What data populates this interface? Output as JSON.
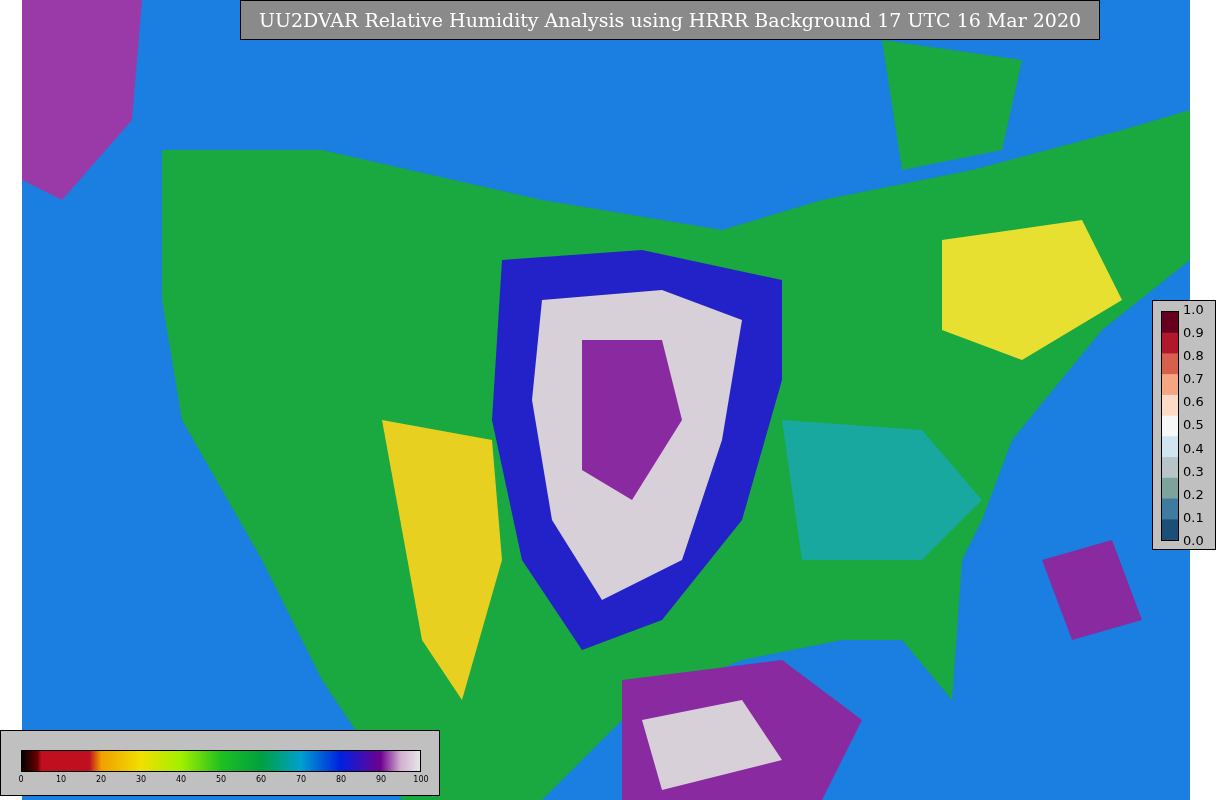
{
  "title": "UU2DVAR Relative Humidity Analysis using HRRR Background 17 UTC 16 Mar 2020",
  "humidity_colorbar": {
    "ticks": [
      "0",
      "10",
      "20",
      "30",
      "40",
      "50",
      "60",
      "70",
      "80",
      "90",
      "100"
    ]
  },
  "value_colorbar": {
    "ticks": [
      "1.0",
      "0.9",
      "0.8",
      "0.7",
      "0.6",
      "0.5",
      "0.4",
      "0.3",
      "0.2",
      "0.1",
      "0.0"
    ]
  }
}
